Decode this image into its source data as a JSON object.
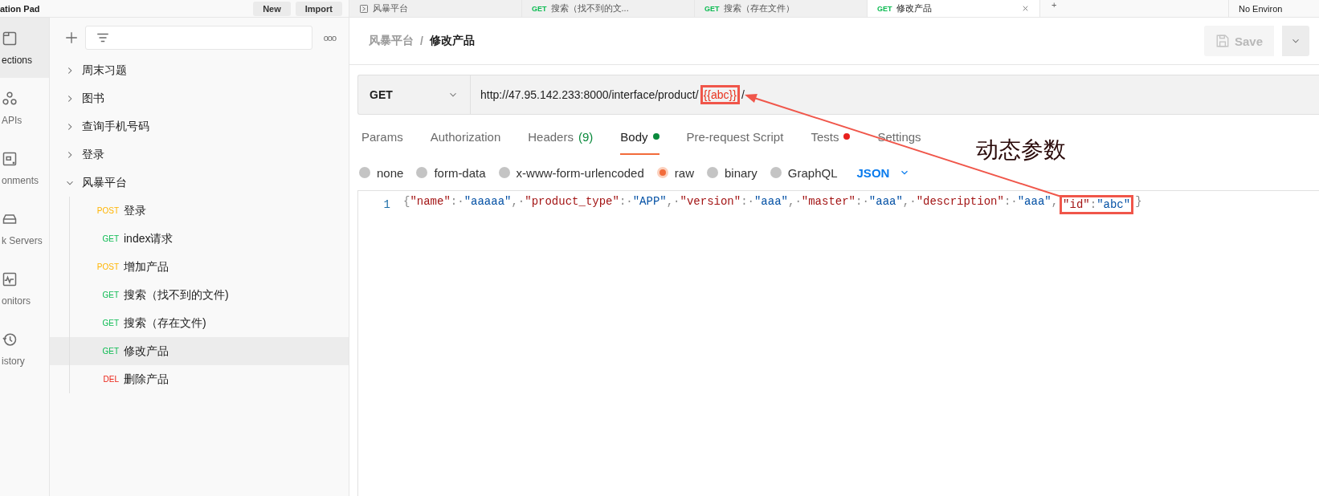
{
  "topbar": {
    "workspace": "ation Pad",
    "buttons": [
      "New",
      "Import"
    ],
    "tabs": [
      {
        "label": "风暴平台",
        "selected": false,
        "closable": false
      },
      {
        "method": "GET",
        "label": "搜索（找不到的文...",
        "selected": false,
        "closable": false
      },
      {
        "method": "GET",
        "label": "搜索（存在文件）",
        "selected": false,
        "closable": false
      },
      {
        "method": "GET",
        "label": "修改产品",
        "selected": true,
        "closable": true
      }
    ],
    "new_tab": "+",
    "environment": "No Environ"
  },
  "rail": [
    {
      "label": "ections",
      "selected": true
    },
    {
      "label": "APIs",
      "selected": false
    },
    {
      "label": "onments",
      "selected": false
    },
    {
      "label": "k Servers",
      "selected": false
    },
    {
      "label": "onitors",
      "selected": false
    },
    {
      "label": "istory",
      "selected": false
    }
  ],
  "sidebar": {
    "more": "ooo",
    "items": [
      {
        "label": "周末习题",
        "expanded": false
      },
      {
        "label": "图书",
        "expanded": false
      },
      {
        "label": "查询手机号码",
        "expanded": false
      },
      {
        "label": "登录",
        "expanded": false
      },
      {
        "label": "风暴平台",
        "expanded": true,
        "children": [
          {
            "method": "POST",
            "label": "登录",
            "selected": false
          },
          {
            "method": "GET",
            "label": "index请求",
            "selected": false
          },
          {
            "method": "POST",
            "label": "增加产品",
            "selected": false
          },
          {
            "method": "GET",
            "label": "搜索（找不到的文件)",
            "selected": false
          },
          {
            "method": "GET",
            "label": "搜索（存在文件)",
            "selected": false
          },
          {
            "method": "GET",
            "label": "修改产品",
            "selected": true
          },
          {
            "method": "DEL",
            "label": "删除产品",
            "selected": false
          }
        ]
      }
    ]
  },
  "request": {
    "breadcrumb": [
      "风暴平台",
      "/",
      "修改产品"
    ],
    "save": "Save",
    "method": "GET",
    "url": [
      {
        "text": "http://47.95.142.233:8000/interface/product/",
        "kind": "plain",
        "highlighted": false
      },
      {
        "text": "{{abc}}",
        "kind": "variable",
        "highlighted": true
      },
      {
        "text": "/",
        "kind": "plain",
        "highlighted": false
      }
    ],
    "tabs": [
      {
        "label": "Params",
        "selected": false
      },
      {
        "label": "Authorization",
        "selected": false
      },
      {
        "label": "Headers",
        "count": "(9)",
        "selected": false
      },
      {
        "label": "Body",
        "color": "#0a8a3c",
        "selected": true
      },
      {
        "label": "Pre-request Script",
        "selected": false
      },
      {
        "label": "Tests",
        "color": "#e8201d",
        "selected": false
      },
      {
        "label": "Settings",
        "selected": false
      }
    ],
    "body_types": [
      {
        "label": "none",
        "selected": false
      },
      {
        "label": "form-data",
        "selected": false
      },
      {
        "label": "x-www-form-urlencoded",
        "selected": false
      },
      {
        "label": "raw",
        "selected": true
      },
      {
        "label": "binary",
        "selected": false
      },
      {
        "label": "GraphQL",
        "selected": false
      }
    ],
    "format": "JSON",
    "editor": {
      "line_number": "1",
      "tokens": [
        {
          "kind": "punct",
          "text": "{",
          "highlighted": false
        },
        {
          "kind": "key",
          "text": "\"name\"",
          "highlighted": false
        },
        {
          "kind": "punct",
          "text": ":·",
          "highlighted": false
        },
        {
          "kind": "string",
          "text": "\"aaaaa\"",
          "highlighted": false
        },
        {
          "kind": "punct",
          "text": ",·",
          "highlighted": false
        },
        {
          "kind": "key",
          "text": "\"product_type\"",
          "highlighted": false
        },
        {
          "kind": "punct",
          "text": ":·",
          "highlighted": false
        },
        {
          "kind": "string",
          "text": "\"APP\"",
          "highlighted": false
        },
        {
          "kind": "punct",
          "text": ",·",
          "highlighted": false
        },
        {
          "kind": "key",
          "text": "\"version\"",
          "highlighted": false
        },
        {
          "kind": "punct",
          "text": ":·",
          "highlighted": false
        },
        {
          "kind": "string",
          "text": "\"aaa\"",
          "highlighted": false
        },
        {
          "kind": "punct",
          "text": ",·",
          "highlighted": false
        },
        {
          "kind": "key",
          "text": "\"master\"",
          "highlighted": false
        },
        {
          "kind": "punct",
          "text": ":·",
          "highlighted": false
        },
        {
          "kind": "string",
          "text": "\"aaa\"",
          "highlighted": false
        },
        {
          "kind": "punct",
          "text": ",·",
          "highlighted": false
        },
        {
          "kind": "key",
          "text": "\"description\"",
          "highlighted": false
        },
        {
          "kind": "punct",
          "text": ":·",
          "highlighted": false
        },
        {
          "kind": "string",
          "text": "\"aaa\"",
          "highlighted": false
        },
        {
          "kind": "punct",
          "text": ",",
          "highlighted": false
        },
        {
          "kind": "key",
          "text": "\"id\"",
          "highlighted": true
        },
        {
          "kind": "punct",
          "text": ":",
          "highlighted": true
        },
        {
          "kind": "string",
          "text": "\"abc\"",
          "highlighted": true
        },
        {
          "kind": "punct",
          "text": "}",
          "highlighted": false
        }
      ]
    }
  },
  "annotation": {
    "label": "动态参数"
  }
}
